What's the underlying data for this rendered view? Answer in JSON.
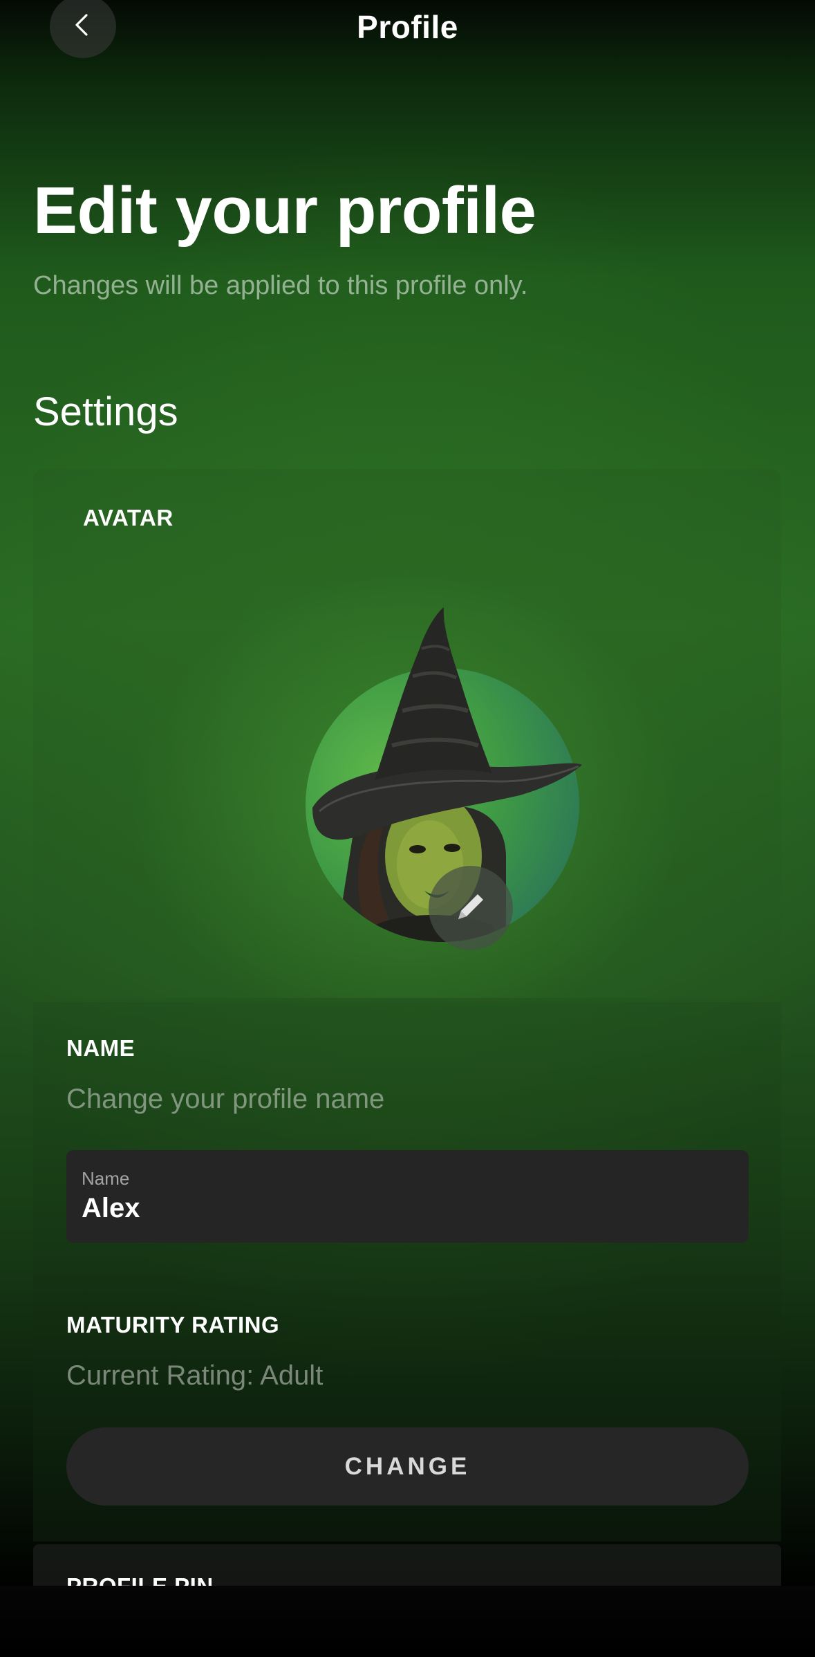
{
  "header": {
    "title": "Profile",
    "back_icon": "chevron-left-icon"
  },
  "page": {
    "title": "Edit your profile",
    "subtitle": "Changes will be applied to this profile only."
  },
  "settings": {
    "section_title": "Settings",
    "avatar": {
      "label": "AVATAR",
      "edit_icon": "pencil-icon"
    },
    "name": {
      "label": "NAME",
      "helper": "Change your profile name",
      "field_label": "Name",
      "field_value": "Alex"
    },
    "maturity": {
      "label": "MATURITY RATING",
      "helper": "Current Rating: Adult",
      "button_label": "CHANGE"
    },
    "profile_pin": {
      "label": "PROFILE PIN"
    }
  },
  "colors": {
    "background_green": "#2a6b24",
    "input_bg": "#252525",
    "button_bg": "#262626"
  }
}
